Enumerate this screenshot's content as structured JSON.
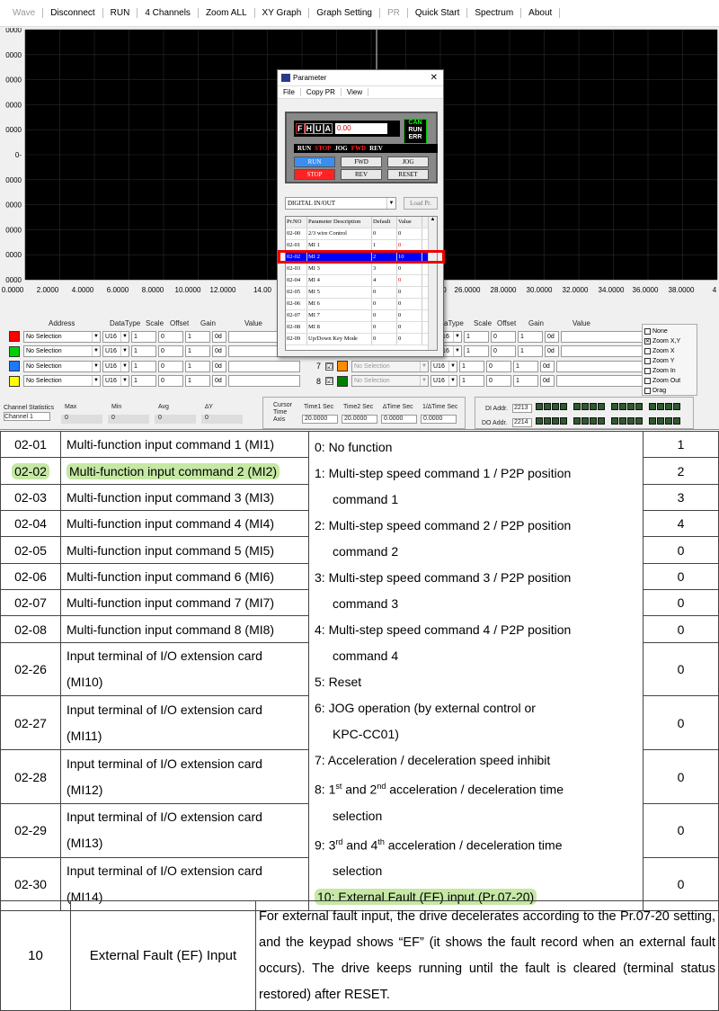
{
  "menubar": {
    "items": [
      "Wave",
      "Disconnect",
      "RUN",
      "4 Channels",
      "Zoom ALL",
      "XY Graph",
      "Graph Setting",
      "PR",
      "Quick Start",
      "Spectrum",
      "About"
    ],
    "disabled": [
      "Wave",
      "PR"
    ]
  },
  "plot": {
    "y_ticks": [
      "0000",
      "0000",
      "0000",
      "0000",
      "0000",
      "0-",
      "0000",
      "0000",
      "0000",
      "0000",
      "0000"
    ],
    "x_ticks": [
      "0.0000",
      "2.0000",
      "4.0000",
      "6.0000",
      "8.0000",
      "10.0000",
      "12.0000",
      "14.00",
      "000",
      "26.0000",
      "28.0000",
      "30.0000",
      "32.0000",
      "34.0000",
      "36.0000",
      "38.0000",
      "4"
    ]
  },
  "channels_left": {
    "headers": {
      "address": "Address",
      "datatype": "DataType",
      "scale": "Scale",
      "offset": "Offset",
      "gain": "Gain",
      "value": "Value"
    },
    "rows": [
      {
        "color": "#ff0000",
        "address": "No Selection",
        "type": "U16",
        "scale": "1",
        "offset": "0",
        "gain": "1",
        "fmt": "0d"
      },
      {
        "color": "#00d000",
        "address": "No Selection",
        "type": "U16",
        "scale": "1",
        "offset": "0",
        "gain": "1",
        "fmt": "0d"
      },
      {
        "color": "#1e78ff",
        "address": "No Selection",
        "type": "U16",
        "scale": "1",
        "offset": "0",
        "gain": "1",
        "fmt": "0d"
      },
      {
        "color": "#ffff00",
        "address": "No Selection",
        "type": "U16",
        "scale": "1",
        "offset": "0",
        "gain": "1",
        "fmt": "0d"
      }
    ]
  },
  "channels_right": {
    "headers": {
      "datatype": "aType",
      "scale": "Scale",
      "offset": "Offset",
      "gain": "Gain",
      "value": "Value"
    },
    "rows": [
      {
        "num": "",
        "color": "",
        "address": "",
        "type": "U16",
        "scale": "1",
        "offset": "0",
        "gain": "1",
        "fmt": "0d"
      },
      {
        "num": "",
        "color": "",
        "address": "",
        "type": "U16",
        "scale": "1",
        "offset": "0",
        "gain": "1",
        "fmt": "0d"
      },
      {
        "num": "7",
        "color": "#ff8c00",
        "address": "No Selection",
        "type": "U16",
        "scale": "1",
        "offset": "0",
        "gain": "1",
        "fmt": "0d"
      },
      {
        "num": "8",
        "color": "#008000",
        "address": "No Selection",
        "type": "U16",
        "scale": "1",
        "offset": "0",
        "gain": "1",
        "fmt": "0d"
      }
    ]
  },
  "zoom_options": [
    {
      "label": "None",
      "checked": false
    },
    {
      "label": "Zoom X,Y",
      "checked": true
    },
    {
      "label": "Zoom X",
      "checked": false
    },
    {
      "label": "Zoom Y",
      "checked": false
    },
    {
      "label": "Zoom In",
      "checked": false
    },
    {
      "label": "Zoom Out",
      "checked": false
    },
    {
      "label": "Drag",
      "checked": false
    }
  ],
  "stats": {
    "channel_statistics": "Channel Statistics",
    "channel": "Channel 1",
    "max": "Max",
    "min": "Min",
    "avg": "Avg",
    "dy": "∆Y",
    "max_v": "0",
    "min_v": "0",
    "avg_v": "0",
    "dy_v": "0",
    "cursor": "Cursor",
    "time": "Time",
    "axis": "Axis",
    "time1": "Time1 Sec",
    "time2": "Time2 Sec",
    "dtime": "∆Time Sec",
    "inv": "1/∆Time Sec",
    "time1_v": "20.0000",
    "time2_v": "20.0000",
    "dtime_v": "0.0000",
    "inv_v": "0.0000",
    "di_addr": "DI Addr.",
    "di_val": "2213",
    "do_addr": "DO Addr.",
    "do_val": "2214"
  },
  "dialog": {
    "title": "Parameter",
    "menu": [
      "File",
      "Copy PR",
      "View"
    ],
    "lcd_seg": [
      "F",
      "H",
      "U",
      "A"
    ],
    "lcd_value": "0.00",
    "can": [
      "CAN",
      "RUN",
      "ERR"
    ],
    "status": [
      "RUN",
      "STOP",
      "JOG",
      "FWD",
      "REV"
    ],
    "buttons": [
      "RUN",
      "FWD",
      "JOG",
      "STOP",
      "REV",
      "RESET"
    ],
    "group": "DIGITAL IN/OUT",
    "load": "Load Pr.",
    "columns": [
      "Pr.NO",
      "Parameter Description",
      "Default",
      "Value"
    ],
    "rows": [
      [
        "02-00",
        "2/3 wire Control",
        "0",
        "0"
      ],
      [
        "02-01",
        "MI 1",
        "1",
        "0"
      ],
      [
        "02-02",
        "MI 2",
        "2",
        "10"
      ],
      [
        "02-03",
        "MI 3",
        "3",
        "0"
      ],
      [
        "02-04",
        "MI 4",
        "4",
        "0"
      ],
      [
        "02-05",
        "MI 5",
        "0",
        "0"
      ],
      [
        "02-06",
        "MI 6",
        "0",
        "0"
      ],
      [
        "02-07",
        "MI 7",
        "0",
        "0"
      ],
      [
        "02-08",
        "MI 8",
        "0",
        "0"
      ],
      [
        "02-09",
        "Up/Down Key Mode",
        "0",
        "0"
      ]
    ]
  },
  "doc_table": {
    "rows": [
      {
        "code": "02-01",
        "desc1": "Multi-function input command 1 (MI1)",
        "desc2": "",
        "def": "1"
      },
      {
        "code": "02-02",
        "desc1": "Multi-function input command 2 (MI2)",
        "desc2": "",
        "def": "2"
      },
      {
        "code": "02-03",
        "desc1": "Multi-function input command 3 (MI3)",
        "desc2": "",
        "def": "3"
      },
      {
        "code": "02-04",
        "desc1": "Multi-function input command 4 (MI4)",
        "desc2": "",
        "def": "4"
      },
      {
        "code": "02-05",
        "desc1": "Multi-function input command 5 (MI5)",
        "desc2": "",
        "def": "0"
      },
      {
        "code": "02-06",
        "desc1": "Multi-function input command 6 (MI6)",
        "desc2": "",
        "def": "0"
      },
      {
        "code": "02-07",
        "desc1": "Multi-function input command 7 (MI7)",
        "desc2": "",
        "def": "0"
      },
      {
        "code": "02-08",
        "desc1": "Multi-function input command 8 (MI8)",
        "desc2": "",
        "def": "0"
      },
      {
        "code": "02-26",
        "desc1": "Input terminal of I/O extension card",
        "desc2": "(MI10)",
        "def": "0"
      },
      {
        "code": "02-27",
        "desc1": "Input terminal of I/O extension card",
        "desc2": "(MI11)",
        "def": "0"
      },
      {
        "code": "02-28",
        "desc1": "Input terminal of I/O extension card",
        "desc2": "(MI12)",
        "def": "0"
      },
      {
        "code": "02-29",
        "desc1": "Input terminal of I/O extension card",
        "desc2": "(MI13)",
        "def": "0"
      },
      {
        "code": "02-30",
        "desc1": "Input terminal of I/O extension card",
        "desc2": "(MI14)",
        "def": "0"
      }
    ],
    "settings": [
      "0: No function",
      "1: Multi-step speed command 1 / P2P position",
      "command 1",
      "2: Multi-step speed command 2 / P2P position",
      "command 2",
      "3: Multi-step speed command 3 / P2P position",
      "command 3",
      "4: Multi-step speed command 4 / P2P position",
      "command 4",
      "5: Reset",
      "6: JOG operation (by external control or",
      "KPC-CC01)",
      "7: Acceleration / deceleration speed inhibit"
    ],
    "s8": {
      "a": "8: 1",
      "sup1": "st",
      "b": " and 2",
      "sup2": "nd",
      "c": " acceleration / deceleration time",
      "d": "selection"
    },
    "s9": {
      "a": "9: 3",
      "sup1": "rd",
      "b": " and 4",
      "sup2": "th",
      "c": " acceleration / deceleration time",
      "d": "selection"
    },
    "s10": "10: External Fault (EF) input (Pr.07-20)"
  },
  "ef_table": {
    "num": "10",
    "name": "External Fault (EF) Input",
    "text": "For external fault input, the drive decelerates according to the Pr.07-20 setting, and the keypad shows “EF” (it shows the fault record when an external fault occurs). The drive keeps running until the fault is cleared (terminal status restored) after RESET."
  }
}
